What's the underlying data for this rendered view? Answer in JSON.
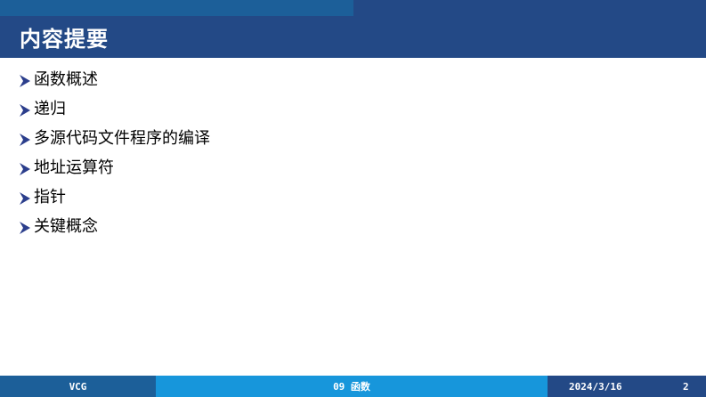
{
  "colors": {
    "title_bar": "#234986",
    "top_left_strip": "#1c5f99",
    "footer_left": "#1c5f99",
    "footer_middle": "#1796db",
    "footer_right": "#234986",
    "bullet": "#2b3e8c",
    "title_text": "#ffffff",
    "body_text": "#000000"
  },
  "slide": {
    "title": "内容提要",
    "bullet_icon": "arrow-bullet-icon",
    "items": [
      {
        "label": "函数概述"
      },
      {
        "label": "递归"
      },
      {
        "label": "多源代码文件程序的编译"
      },
      {
        "label": "地址运算符"
      },
      {
        "label": "指针"
      },
      {
        "label": "关键概念"
      }
    ]
  },
  "footer": {
    "author": "VCG",
    "chapter": "09 函数",
    "date": "2024/3/16",
    "page_number": "2"
  }
}
